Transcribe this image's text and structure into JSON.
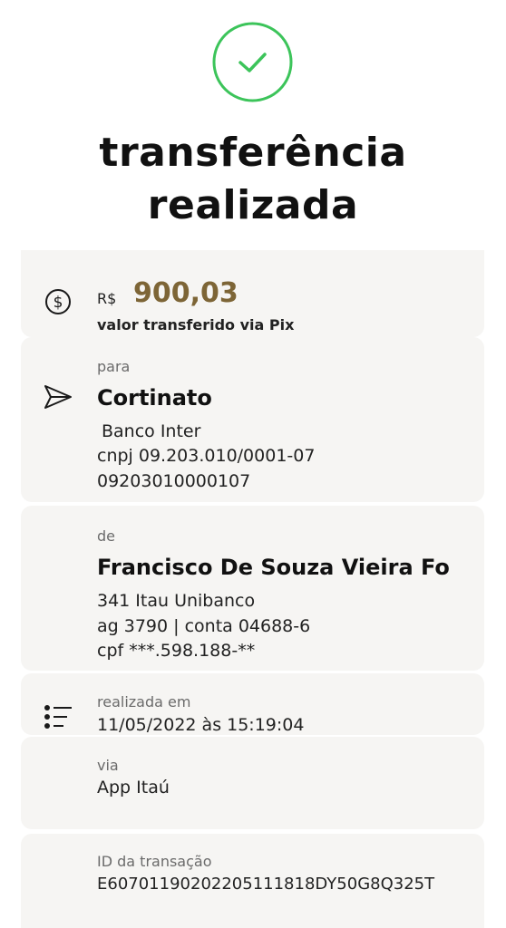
{
  "header": {
    "status_icon": "check-circle-icon",
    "title_line1": "transferência",
    "title_line2": "realizada"
  },
  "amount": {
    "icon": "dollar-circle-icon",
    "currency": "R$",
    "value": "900,03",
    "description": "valor transferido via Pix"
  },
  "recipient": {
    "icon": "send-icon",
    "label": "para",
    "name": "Cortinato",
    "bank": "Banco Inter",
    "document": "cnpj 09.203.010/0001-07",
    "key": "09203010000107"
  },
  "sender": {
    "label": "de",
    "name": "Francisco De Souza Vieira Fo",
    "bank": "341 Itau Unibanco",
    "account": "ag 3790 | conta 04688-6",
    "document": "cpf ***.598.188-**"
  },
  "date": {
    "icon": "list-icon",
    "label": "realizada em",
    "value": "11/05/2022 às 15:19:04"
  },
  "channel": {
    "label": "via",
    "value": "App Itaú"
  },
  "transaction": {
    "label": "ID da transação",
    "value": "E60701190202205111818DY50G8Q325T"
  },
  "colors": {
    "success": "#3cc45a",
    "amount": "#7d6536",
    "card_background": "#f6f5f3"
  }
}
